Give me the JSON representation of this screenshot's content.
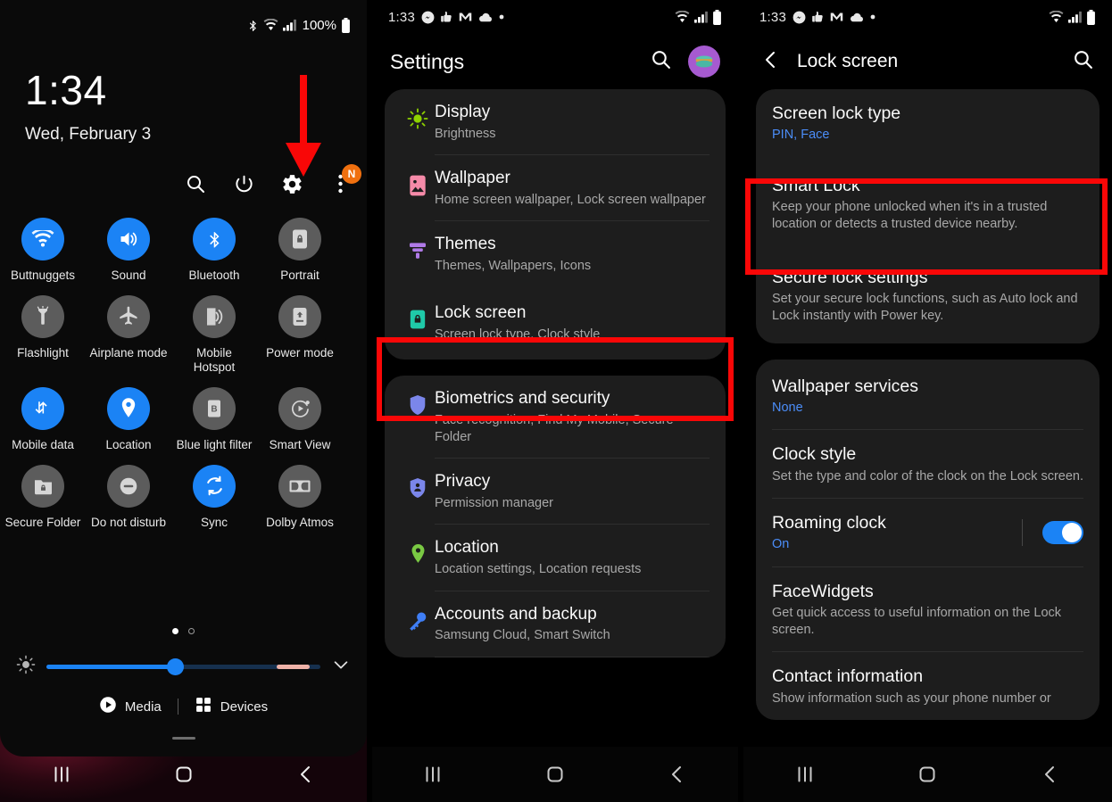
{
  "panel1": {
    "status": {
      "bluetooth": "bluetooth-icon",
      "wifi": "wifi-icon",
      "signal": "signal-icon",
      "battery_text": "100%",
      "battery": "battery-icon"
    },
    "clock": {
      "time": "1:34",
      "date": "Wed, February 3"
    },
    "top_icons": [
      {
        "name": "search-icon",
        "label": "Search"
      },
      {
        "name": "power-icon",
        "label": "Power"
      },
      {
        "name": "gear-icon",
        "label": "Settings"
      },
      {
        "name": "overflow-menu-icon",
        "label": "More options",
        "badge": "N"
      }
    ],
    "tiles": [
      {
        "label": "Buttnuggets",
        "icon": "wifi-icon",
        "state": "on"
      },
      {
        "label": "Sound",
        "icon": "volume-icon",
        "state": "on"
      },
      {
        "label": "Bluetooth",
        "icon": "bluetooth-icon",
        "state": "on"
      },
      {
        "label": "Portrait",
        "icon": "rotation-lock-icon",
        "state": "off"
      },
      {
        "label": "Flashlight",
        "icon": "flashlight-icon",
        "state": "off"
      },
      {
        "label": "Airplane mode",
        "icon": "airplane-icon",
        "state": "off"
      },
      {
        "label": "Mobile Hotspot",
        "icon": "hotspot-icon",
        "state": "off"
      },
      {
        "label": "Power mode",
        "icon": "power-mode-icon",
        "state": "off"
      },
      {
        "label": "Mobile data",
        "icon": "mobile-data-icon",
        "state": "on"
      },
      {
        "label": "Location",
        "icon": "location-pin-icon",
        "state": "on"
      },
      {
        "label": "Blue light filter",
        "icon": "blue-light-filter-icon",
        "state": "off"
      },
      {
        "label": "Smart View",
        "icon": "smart-view-icon",
        "state": "off"
      },
      {
        "label": "Secure Folder",
        "icon": "secure-folder-icon",
        "state": "off"
      },
      {
        "label": "Do not disturb",
        "icon": "do-not-disturb-icon",
        "state": "off"
      },
      {
        "label": "Sync",
        "icon": "sync-icon",
        "state": "on"
      },
      {
        "label": "Dolby Atmos",
        "icon": "dolby-atmos-icon",
        "state": "off"
      }
    ],
    "pager": {
      "pages": 2,
      "current": 1
    },
    "brightness": {
      "icon": "brightness-icon",
      "percent": 48,
      "expand_icon": "chevron-down-icon",
      "accent": "#1b83f5"
    },
    "footer": {
      "media_label": "Media",
      "media_icon": "play-circle-icon",
      "devices_label": "Devices",
      "devices_icon": "devices-grid-icon"
    },
    "nav": {
      "recents": "recents-icon",
      "home": "home-icon",
      "back": "back-icon"
    },
    "annotation": {
      "arrow": "red-down-arrow",
      "color": "#f90707"
    }
  },
  "panel2": {
    "status": {
      "time": "1:33",
      "icons": [
        "messenger-icon",
        "thumb-icon",
        "gmail-icon",
        "cloud-icon",
        "dot-icon"
      ],
      "right": [
        "wifi-icon",
        "signal-icon",
        "battery-icon"
      ]
    },
    "header": {
      "title": "Settings",
      "search_icon": "search-icon",
      "avatar": "account-avatar"
    },
    "groups": [
      {
        "items": [
          {
            "icon": "display-brightness-icon",
            "title": "Display",
            "subtitle": "Brightness",
            "color": "#8ed200"
          },
          {
            "icon": "wallpaper-icon",
            "title": "Wallpaper",
            "subtitle": "Home screen wallpaper, Lock screen wallpaper",
            "color": "#f58aa8"
          },
          {
            "icon": "themes-brush-icon",
            "title": "Themes",
            "subtitle": "Themes, Wallpapers, Icons",
            "color": "#b07ae8"
          },
          {
            "icon": "lock-screen-icon",
            "title": "Lock screen",
            "subtitle": "Screen lock type, Clock style",
            "color": "#1fc9a8",
            "highlighted": true
          }
        ]
      },
      {
        "items": [
          {
            "icon": "shield-icon",
            "title": "Biometrics and security",
            "subtitle": "Face recognition, Find My Mobile, Secure Folder",
            "color": "#7b86ea"
          },
          {
            "icon": "privacy-shield-person-icon",
            "title": "Privacy",
            "subtitle": "Permission manager",
            "color": "#7b86ea"
          },
          {
            "icon": "location-pin-icon",
            "title": "Location",
            "subtitle": "Location settings, Location requests",
            "color": "#7ac943"
          },
          {
            "icon": "key-icon",
            "title": "Accounts and backup",
            "subtitle": "Samsung Cloud, Smart Switch",
            "color": "#3f7ef5"
          }
        ]
      }
    ],
    "nav": {
      "recents": "recents-icon",
      "home": "home-icon",
      "back": "back-icon"
    },
    "annotation": {
      "color": "#f90707"
    }
  },
  "panel3": {
    "status": {
      "time": "1:33",
      "icons": [
        "messenger-icon",
        "thumb-icon",
        "gmail-icon",
        "cloud-icon",
        "dot-icon"
      ],
      "right": [
        "wifi-icon",
        "signal-icon",
        "battery-icon"
      ]
    },
    "header": {
      "back_icon": "back-arrow-icon",
      "title": "Lock screen",
      "search_icon": "search-icon"
    },
    "groups": [
      {
        "items": [
          {
            "title": "Screen lock type",
            "subtitle": "PIN, Face",
            "subtitle_style": "blue"
          },
          {
            "title": "Smart Lock",
            "subtitle": "Keep your phone unlocked when it's in a trusted location or detects a trusted device nearby.",
            "highlighted": true
          },
          {
            "title": "Secure lock settings",
            "subtitle": "Set your secure lock functions, such as Auto lock and Lock instantly with Power key."
          }
        ]
      },
      {
        "items": [
          {
            "title": "Wallpaper services",
            "subtitle": "None",
            "subtitle_style": "blue"
          },
          {
            "title": "Clock style",
            "subtitle": "Set the type and color of the clock on the Lock screen."
          },
          {
            "title": "Roaming clock",
            "subtitle": "On",
            "subtitle_style": "blue",
            "toggle": "on"
          },
          {
            "title": "FaceWidgets",
            "subtitle": "Get quick access to useful information on the Lock screen."
          },
          {
            "title": "Contact information",
            "subtitle": "Show information such as your phone number or"
          }
        ]
      }
    ],
    "nav": {
      "recents": "recents-icon",
      "home": "home-icon",
      "back": "back-icon"
    },
    "annotation": {
      "color": "#f90707"
    }
  }
}
